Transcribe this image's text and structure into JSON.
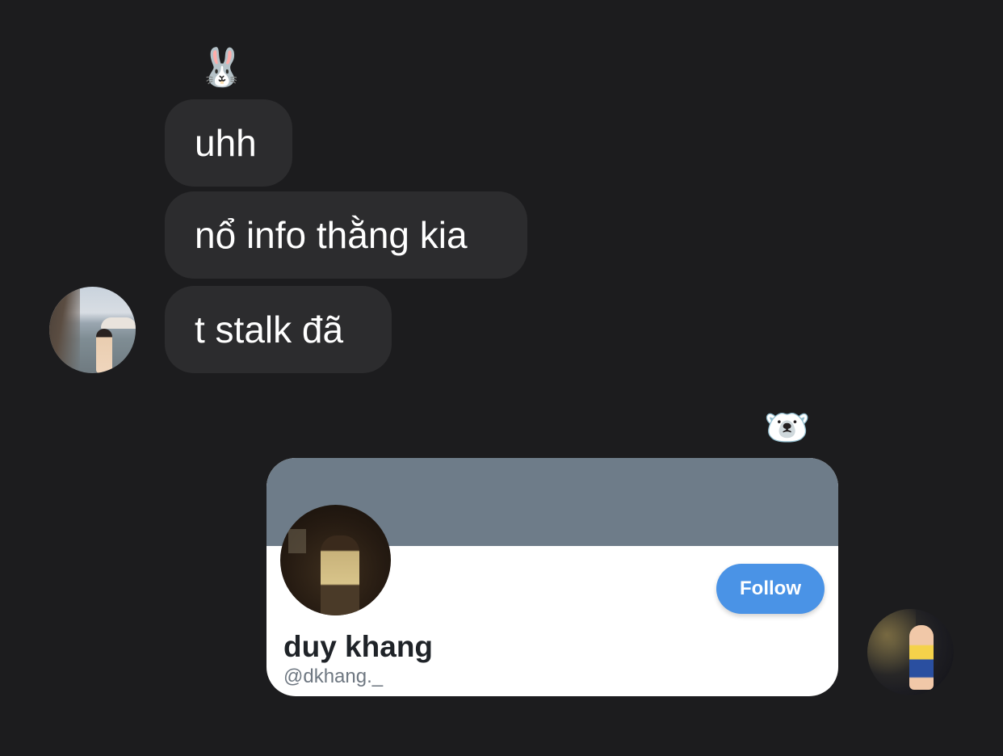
{
  "conversation": {
    "incoming": {
      "reaction_emoji": "🐰",
      "messages": [
        "uhh",
        "nổ info thằng kia",
        "t stalk đã"
      ]
    },
    "outgoing": {
      "reaction_emoji": "🐻‍❄️",
      "profile_card": {
        "display_name": "duy khang",
        "handle": "@dkhang._",
        "follow_label": "Follow",
        "banner_color": "#6e7c89",
        "follow_color": "#4a93e6"
      }
    }
  },
  "theme": {
    "background": "#1c1c1e",
    "bubble": "#2c2c2e"
  }
}
